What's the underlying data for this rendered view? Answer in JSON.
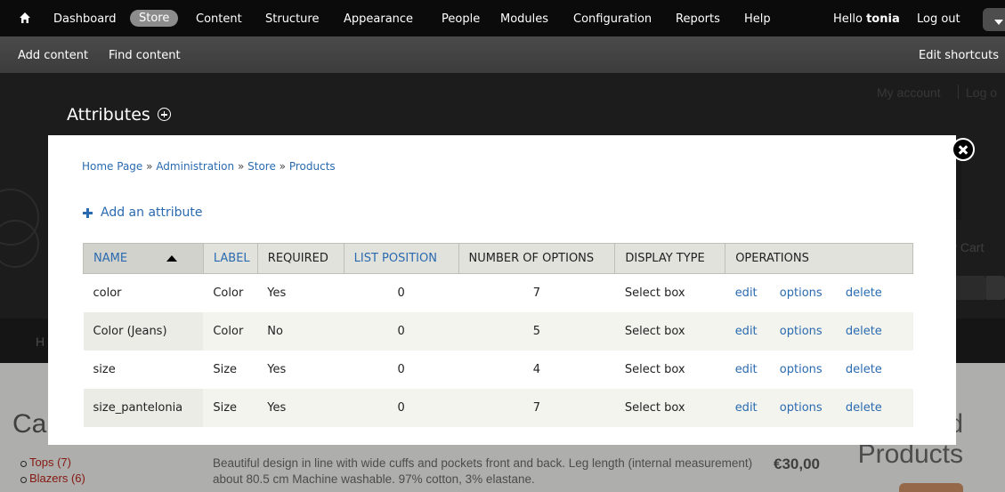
{
  "toolbar": {
    "menu": [
      {
        "label": "Dashboard"
      },
      {
        "label": "Store",
        "active": true
      },
      {
        "label": "Content"
      },
      {
        "label": "Structure"
      },
      {
        "label": "Appearance"
      },
      {
        "label": "People"
      },
      {
        "label": "Modules"
      },
      {
        "label": "Configuration"
      },
      {
        "label": "Reports"
      },
      {
        "label": "Help"
      }
    ],
    "hello": "Hello",
    "username": "tonia",
    "logout": "Log out",
    "shortcuts": [
      {
        "label": "Add content"
      },
      {
        "label": "Find content"
      }
    ],
    "edit_shortcuts": "Edit shortcuts",
    "icons": {
      "home": "home-icon",
      "toggle": "chevron-down-icon"
    }
  },
  "site": {
    "account_links": [
      "My account",
      "Log o"
    ],
    "cart": "y Cart",
    "nav_first": "H",
    "categories_title": "Ca",
    "categories": [
      "Tops (7)",
      "Blazers (6)"
    ],
    "description": "Beautiful design in line with wide cuffs and pockets front and back. Leg length (internal measurement) about 80.5 cm Machine washable. 97% cotton, 3% elastane.",
    "price": "€30,00",
    "featured_title": [
      "d",
      "Products"
    ]
  },
  "overlay": {
    "title": "Attributes",
    "breadcrumb": [
      "Home Page",
      "Administration",
      "Store",
      "Products"
    ],
    "breadcrumb_sep": "»",
    "add_link": "Add an attribute",
    "table": {
      "headers": [
        "NAME",
        "LABEL",
        "REQUIRED",
        "LIST POSITION",
        "NUMBER OF OPTIONS",
        "DISPLAY TYPE",
        "OPERATIONS"
      ],
      "rows": [
        {
          "name": "color",
          "label": "Color",
          "required": "Yes",
          "list_position": "0",
          "options": "7",
          "display_type": "Select box"
        },
        {
          "name": "Color (Jeans)",
          "label": "Color",
          "required": "No",
          "list_position": "0",
          "options": "5",
          "display_type": "Select box"
        },
        {
          "name": "size",
          "label": "Size",
          "required": "Yes",
          "list_position": "0",
          "options": "4",
          "display_type": "Select box"
        },
        {
          "name": "size_pantelonia",
          "label": "Size",
          "required": "Yes",
          "list_position": "0",
          "options": "7",
          "display_type": "Select box"
        }
      ],
      "operations": [
        "edit",
        "options",
        "delete"
      ]
    }
  },
  "colors": {
    "link": "#2a6ab0",
    "toolbar_bg": "#0b0b0b",
    "shortcut_bg": "#444444",
    "active_tab": "#8c8c8c",
    "category_link": "#b2231b"
  }
}
